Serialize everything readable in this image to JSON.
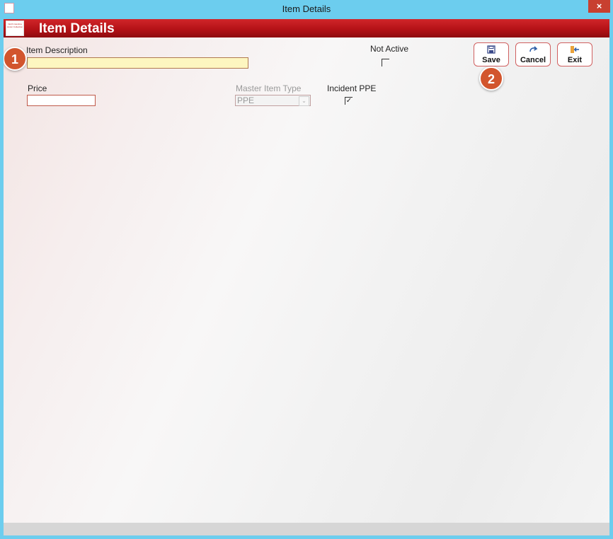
{
  "window": {
    "title": "Item Details",
    "close_label": "×"
  },
  "banner": {
    "title": "Item Details",
    "logo_text": "North Carolina Junior Collection"
  },
  "form": {
    "item_description": {
      "label": "Item Description",
      "value": ""
    },
    "not_active": {
      "label": "Not Active",
      "checked": false,
      "mark": ""
    },
    "price": {
      "label": "Price",
      "value": ""
    },
    "master_item_type": {
      "label": "Master Item Type",
      "value": "PPE",
      "disabled": true,
      "arrow": "⌄"
    },
    "incident_ppe": {
      "label": "Incident PPE",
      "checked": true,
      "mark": "✓"
    }
  },
  "toolbar": {
    "save_label": "Save",
    "cancel_label": "Cancel",
    "exit_label": "Exit",
    "save_icon": "floppy-disk-icon",
    "cancel_icon": "undo-arrow-icon",
    "exit_icon": "exit-door-icon"
  },
  "callouts": {
    "one": "1",
    "two": "2"
  },
  "colors": {
    "banner_red": "#b51217",
    "title_bar": "#6ccdee",
    "callout_orange": "#d2552d",
    "field_yellow": "#fdf6c0"
  }
}
